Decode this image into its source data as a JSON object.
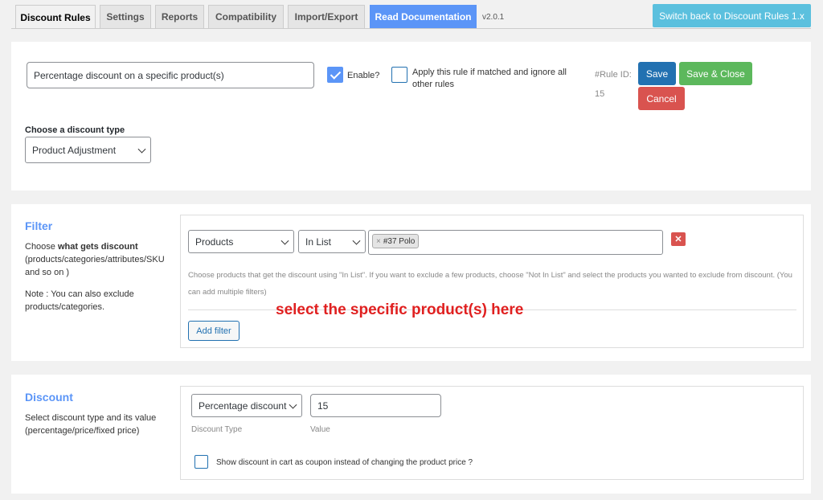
{
  "tabs": [
    {
      "label": "Discount Rules"
    },
    {
      "label": "Settings"
    },
    {
      "label": "Reports"
    },
    {
      "label": "Compatibility"
    },
    {
      "label": "Import/Export"
    },
    {
      "label": "Read Documentation"
    }
  ],
  "version": "v2.0.1",
  "switch_button": "Switch back to Discount Rules 1.x",
  "rule": {
    "title_value": "Percentage discount on a specific product(s)",
    "enable_label": "Enable?",
    "enable_checked": true,
    "apply_label": "Apply this rule if matched and ignore all other rules",
    "rule_id_label": "#Rule ID:",
    "rule_id": "15",
    "save": "Save",
    "save_close": "Save & Close",
    "cancel": "Cancel",
    "discount_type_label": "Choose a discount type",
    "discount_type_value": "Product Adjustment"
  },
  "filter": {
    "heading": "Filter",
    "help_prefix": "Choose ",
    "help_bold": "what gets discount",
    "help_rest": "(products/categories/attributes/SKU and so on )",
    "note": "Note : You can also exclude products/categories.",
    "type_value": "Products",
    "operator_value": "In List",
    "tag_remove": "×",
    "tag_label": "#37 Polo",
    "hint": "Choose products that get the discount using \"In List\". If you want to exclude a few products, choose \"Not In List\" and select the products you wanted to exclude from discount. (You can add multiple filters)",
    "annotation": "select the specific product(s) here",
    "add_filter": "Add filter",
    "remove_glyph": "✕"
  },
  "discount": {
    "heading": "Discount",
    "help": "Select discount type and its value (percentage/price/fixed price)",
    "type_value": "Percentage discount",
    "value": "15",
    "type_caption": "Discount Type",
    "value_caption": "Value",
    "coupon_label": "Show discount in cart as coupon instead of changing the product price ?"
  },
  "colors": {
    "primary": "#5b95f7",
    "save": "#2271b1",
    "save_close": "#5cb85c",
    "cancel": "#d9534f",
    "switch": "#5bc0de",
    "annotation": "#e02020"
  }
}
